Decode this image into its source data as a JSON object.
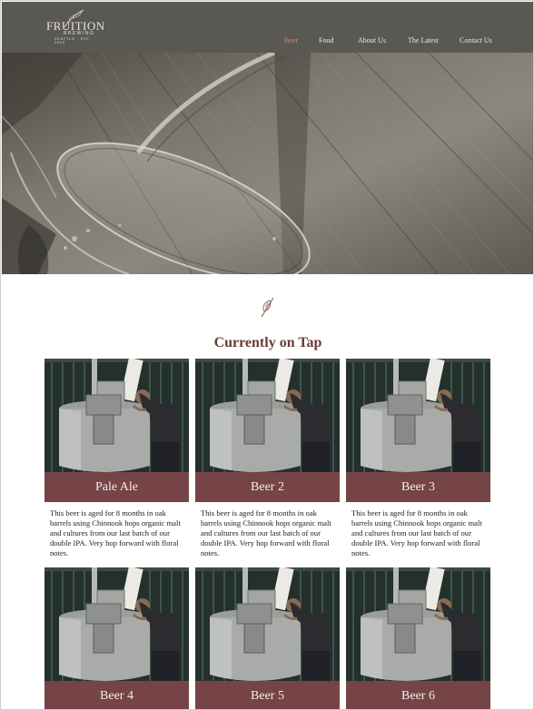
{
  "logo": {
    "name": "FRUITION",
    "sub": "BREWING",
    "tagline": "SEATTLE - EST. 2019"
  },
  "nav": [
    {
      "label": "Beer",
      "active": true
    },
    {
      "label": "Food",
      "active": false
    },
    {
      "label": "About Us",
      "active": false
    },
    {
      "label": "The Latest",
      "active": false
    },
    {
      "label": "Contact Us",
      "active": false
    }
  ],
  "colors": {
    "header_bg": "#595853",
    "accent": "#764446",
    "title": "#6b3a36",
    "nav_active": "#c98b72"
  },
  "hero": {
    "icon": "hop-leaf-icon"
  },
  "section": {
    "title": "Currently on Tap"
  },
  "beers": [
    {
      "name": "Pale Ale",
      "description": "This beer is aged for 8 months in oak barrels using Chinnook hops organic malt and cultures from our last batch of our double IPA. Very hop forward with floral notes."
    },
    {
      "name": "Beer 2",
      "description": "This beer is aged for 8 months in oak barrels using Chinnook hops organic malt and cultures from our last batch of our double IPA. Very hop forward with floral notes."
    },
    {
      "name": "Beer 3",
      "description": "This beer is aged for 8 months in oak barrels using Chinnook hops organic malt and cultures from our last batch of our double IPA. Very hop forward with floral notes."
    },
    {
      "name": "Beer 4",
      "description": ""
    },
    {
      "name": "Beer 5",
      "description": ""
    },
    {
      "name": "Beer 6",
      "description": ""
    }
  ]
}
